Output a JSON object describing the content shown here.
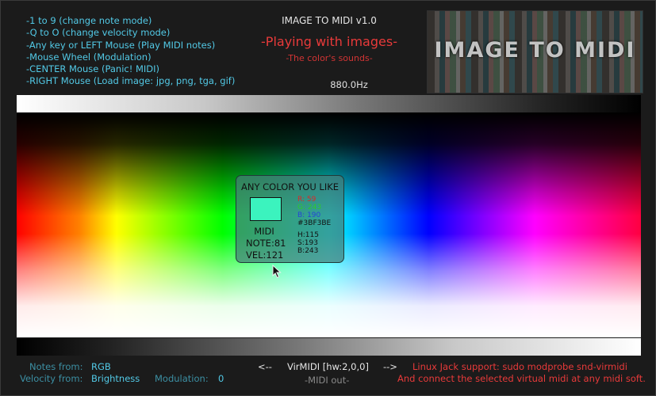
{
  "instructions": [
    "-1 to 9 (change note mode)",
    "-Q to O (change velocity mode)",
    "-Any key or LEFT Mouse (Play MIDI notes)",
    "-Mouse Wheel (Modulation)",
    "-CENTER Mouse (Panic! MIDI)",
    "-RIGHT Mouse (Load image: jpg, png, tga, gif)"
  ],
  "header": {
    "app_title": "IMAGE TO MIDI v1.0",
    "subtitle": "-Playing with images-",
    "tagline": "-The color's sounds-",
    "frequency": "880.0Hz",
    "logo_text": "IMAGE TO MIDI"
  },
  "color_panel": {
    "title": "ANY COLOR YOU LIKE",
    "swatch_color": "#3BF3BE",
    "midi_label": "MIDI",
    "note": "NOTE:81",
    "velocity": "VEL:121",
    "r": "R: 59",
    "g": "G: 243",
    "b": "B: 190",
    "hex": "#3BF3BE",
    "h": "H:115",
    "s": "S:193",
    "bv": "B:243"
  },
  "footer": {
    "notes_from_label": "Notes from:",
    "notes_from_value": "RGB",
    "velocity_from_label": "Velocity from:",
    "velocity_from_value": "Brightness",
    "modulation_label": "Modulation:",
    "modulation_value": "0",
    "prev_arrow": "<--",
    "midi_device": "VirMIDI [hw:2,0,0]",
    "next_arrow": "-->",
    "midi_out": "-MIDI out-",
    "jack_info": "Linux Jack support: sudo modprobe snd-virmidi",
    "connect_info": "And connect the selected virtual midi at any midi soft."
  },
  "colors": {
    "accent_cyan": "#52c9e6",
    "accent_red": "#e83a3a"
  }
}
